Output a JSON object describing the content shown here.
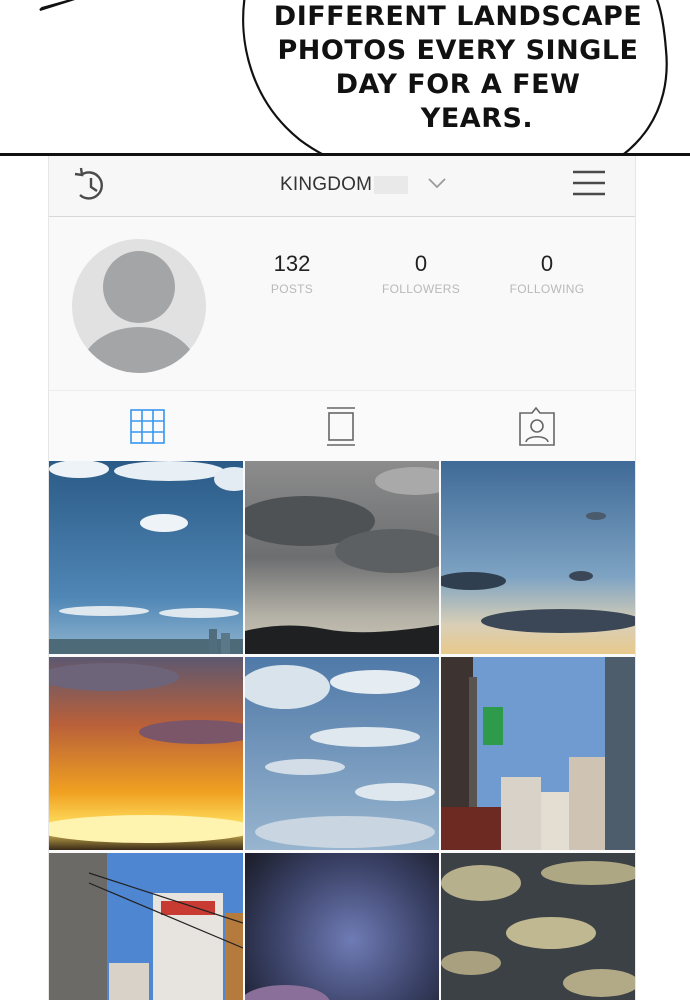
{
  "speech_bubble": {
    "lines": [
      "DIFFERENT LANDSCAPE",
      "PHOTOS EVERY SINGLE",
      "DAY FOR A FEW",
      "YEARS."
    ]
  },
  "header": {
    "username": "KINGDOM",
    "icons": [
      "history-icon",
      "chevron-down-icon",
      "menu-icon"
    ]
  },
  "profile": {
    "stats": [
      {
        "value": "132",
        "label": "POSTS"
      },
      {
        "value": "0",
        "label": "FOLLOWERS"
      },
      {
        "value": "0",
        "label": "FOLLOWING"
      }
    ]
  },
  "tabs": [
    {
      "icon": "grid-icon",
      "active": true
    },
    {
      "icon": "feed-icon",
      "active": false
    },
    {
      "icon": "tagged-icon",
      "active": false
    }
  ],
  "grid": {
    "photos": [
      "clouds-blue-sky-city",
      "gray-overcast-treeline",
      "blue-sky-dark-clouds",
      "orange-sunset",
      "scattered-clouds-blue",
      "city-street-signs",
      "buildings-power-lines",
      "dark-storm-clouds",
      "cloudy-dark-sky"
    ]
  },
  "colors": {
    "accent_blue": "#3897f0",
    "icon_gray": "#4a4a4a",
    "avatar_gray": "#a3a5a7"
  }
}
